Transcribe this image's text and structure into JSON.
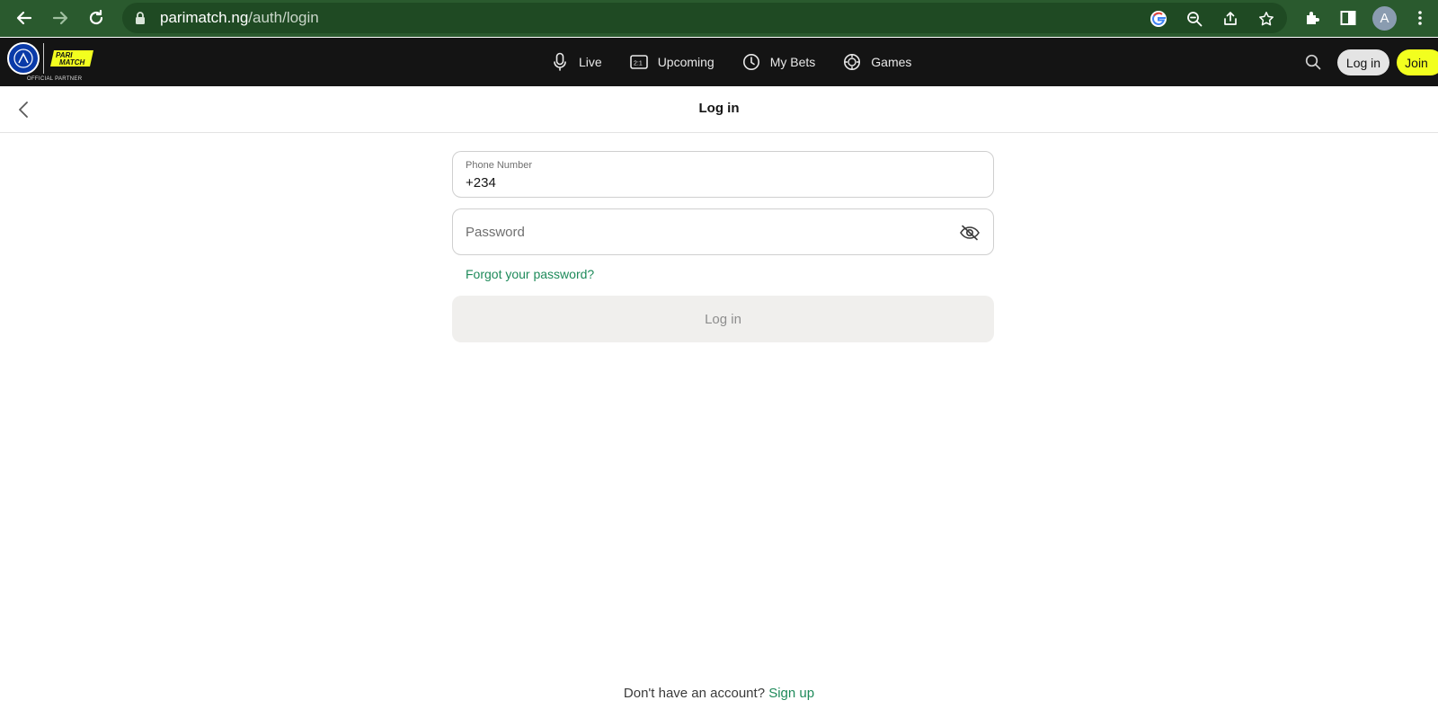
{
  "browser": {
    "url_host": "parimatch.ng",
    "url_path": "/auth/login",
    "profile_initial": "A"
  },
  "header": {
    "partner_text": "OFFICIAL PARTNER",
    "logo_text": "PARI MATCH",
    "nav": [
      {
        "label": "Live",
        "icon": "microphone-icon"
      },
      {
        "label": "Upcoming",
        "icon": "scoreboard-icon"
      },
      {
        "label": "My Bets",
        "icon": "clock-icon"
      },
      {
        "label": "Games",
        "icon": "gamepad-icon"
      }
    ],
    "login_label": "Log in",
    "join_label": "Join",
    "accent_color": "#f2ff1f"
  },
  "page": {
    "title": "Log in"
  },
  "form": {
    "phone_label": "Phone Number",
    "phone_value": "+234",
    "password_placeholder": "Password",
    "forgot_label": "Forgot your password?",
    "submit_label": "Log in",
    "link_color": "#1e8a5a"
  },
  "footer": {
    "no_account_text": "Don't have an account?",
    "signup_label": "Sign up"
  }
}
